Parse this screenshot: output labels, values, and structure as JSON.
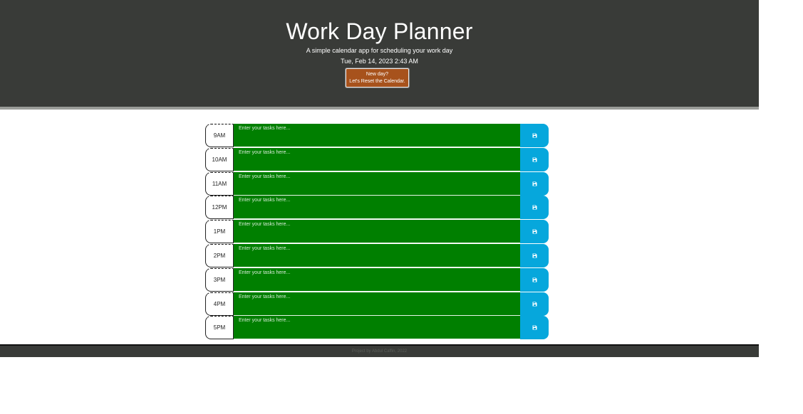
{
  "header": {
    "title": "Work Day Planner",
    "lead": "A simple calendar app for scheduling your work day",
    "current_day": "Tue, Feb 14, 2023 2:43 AM",
    "reset_line1": "New day?",
    "reset_line2": "Let's Reset the Calendar."
  },
  "planner": {
    "task_placeholder": "Enter your tasks here...",
    "task_color": "#007f00",
    "save_color": "#06a7dc",
    "save_icon": "floppy-disk-icon",
    "rows": [
      {
        "hour": "9AM"
      },
      {
        "hour": "10AM"
      },
      {
        "hour": "11AM"
      },
      {
        "hour": "12PM"
      },
      {
        "hour": "1PM"
      },
      {
        "hour": "2PM"
      },
      {
        "hour": "3PM"
      },
      {
        "hour": "4PM"
      },
      {
        "hour": "5PM"
      }
    ]
  },
  "footer": {
    "text": "Project by Abdul Caffin, 2022"
  }
}
